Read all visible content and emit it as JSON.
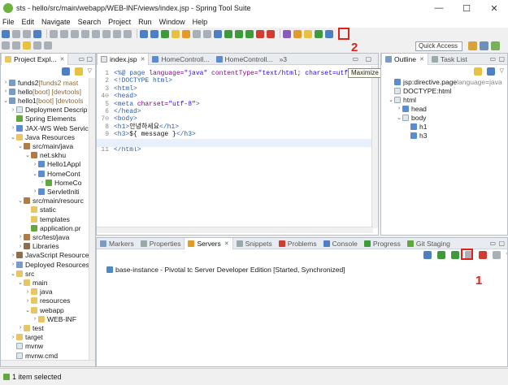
{
  "window": {
    "title": "sts - hello/src/main/webapp/WEB-INF/views/index.jsp - Spring Tool Suite",
    "minimize": "—",
    "maximize": "☐",
    "close": "✕"
  },
  "menu": [
    "File",
    "Edit",
    "Navigate",
    "Search",
    "Project",
    "Run",
    "Window",
    "Help"
  ],
  "toolbar": {
    "quick_access": "Quick Access"
  },
  "explorer": {
    "tab_label": "Project Expl...",
    "tree": [
      {
        "label": "funds2",
        "deco": " [funds2 mast",
        "indent": 0,
        "tw": "›",
        "icon": "proj"
      },
      {
        "label": "hello",
        "deco": " [boot] [devtools]",
        "indent": 0,
        "tw": "›",
        "icon": "proj"
      },
      {
        "label": "hello1",
        "deco": " [boot] [devtools",
        "indent": 0,
        "tw": "⌄",
        "icon": "proj"
      },
      {
        "label": "Deployment Descrip",
        "deco": "",
        "indent": 1,
        "tw": "›",
        "icon": "doc"
      },
      {
        "label": "Spring Elements",
        "deco": "",
        "indent": 1,
        "tw": "",
        "icon": "green"
      },
      {
        "label": "JAX-WS Web Servic",
        "deco": "",
        "indent": 1,
        "tw": "›",
        "icon": "java"
      },
      {
        "label": "Java Resources",
        "deco": "",
        "indent": 1,
        "tw": "⌄",
        "icon": "folder"
      },
      {
        "label": "src/main/java",
        "deco": "",
        "indent": 2,
        "tw": "⌄",
        "icon": "pkg"
      },
      {
        "label": "net.skhu",
        "deco": "",
        "indent": 3,
        "tw": "⌄",
        "icon": "pkg"
      },
      {
        "label": "Hello1Appl",
        "deco": "",
        "indent": 4,
        "tw": "›",
        "icon": "java"
      },
      {
        "label": "HomeCont",
        "deco": "",
        "indent": 4,
        "tw": "⌄",
        "icon": "java"
      },
      {
        "label": "HomeCo",
        "deco": "",
        "indent": 5,
        "tw": "›",
        "icon": "green"
      },
      {
        "label": "ServletIniti",
        "deco": "",
        "indent": 4,
        "tw": "›",
        "icon": "java"
      },
      {
        "label": "src/main/resourc",
        "deco": "",
        "indent": 2,
        "tw": "⌄",
        "icon": "pkg"
      },
      {
        "label": "static",
        "deco": "",
        "indent": 3,
        "tw": "",
        "icon": "folder"
      },
      {
        "label": "templates",
        "deco": "",
        "indent": 3,
        "tw": "",
        "icon": "folder"
      },
      {
        "label": "application.pr",
        "deco": "",
        "indent": 3,
        "tw": "",
        "icon": "green"
      },
      {
        "label": "src/test/java",
        "deco": "",
        "indent": 2,
        "tw": "›",
        "icon": "pkg"
      },
      {
        "label": "Libraries",
        "deco": "",
        "indent": 2,
        "tw": "›",
        "icon": "lib"
      },
      {
        "label": "JavaScript Resources",
        "deco": "",
        "indent": 1,
        "tw": "›",
        "icon": "lib"
      },
      {
        "label": "Deployed Resources",
        "deco": "",
        "indent": 1,
        "tw": "›",
        "icon": "proj"
      },
      {
        "label": "src",
        "deco": "",
        "indent": 1,
        "tw": "⌄",
        "icon": "folder"
      },
      {
        "label": "main",
        "deco": "",
        "indent": 2,
        "tw": "⌄",
        "icon": "folder"
      },
      {
        "label": "java",
        "deco": "",
        "indent": 3,
        "tw": "›",
        "icon": "folder"
      },
      {
        "label": "resources",
        "deco": "",
        "indent": 3,
        "tw": "›",
        "icon": "folder"
      },
      {
        "label": "webapp",
        "deco": "",
        "indent": 3,
        "tw": "⌄",
        "icon": "folder"
      },
      {
        "label": "WEB-INF",
        "deco": "",
        "indent": 4,
        "tw": "›",
        "icon": "folder"
      },
      {
        "label": "test",
        "deco": "",
        "indent": 2,
        "tw": "›",
        "icon": "folder"
      },
      {
        "label": "target",
        "deco": "",
        "indent": 1,
        "tw": "›",
        "icon": "folder"
      },
      {
        "label": "mvnw",
        "deco": "",
        "indent": 1,
        "tw": "",
        "icon": "doc"
      },
      {
        "label": "mvnw.cmd",
        "deco": "",
        "indent": 1,
        "tw": "",
        "icon": "doc"
      }
    ]
  },
  "editor": {
    "tabs": [
      "index.jsp",
      "HomeControll...",
      "HomeControll...",
      "»3"
    ],
    "lines": [
      {
        "n": "1",
        "parts": [
          [
            "tag",
            "<%@ page "
          ],
          [
            "attr",
            "language="
          ],
          [
            "val",
            "\"java\""
          ],
          [
            "attr",
            " contentType="
          ],
          [
            "val",
            "\"text/html; charset=utf-8\""
          ],
          [
            "attr",
            " pageEnc"
          ]
        ]
      },
      {
        "n": "2",
        "parts": [
          [
            "tag",
            "<!DOCTYPE html>"
          ]
        ]
      },
      {
        "n": "3",
        "parts": [
          [
            "tag",
            "<html>"
          ]
        ]
      },
      {
        "n": "4⊖",
        "parts": [
          [
            "tag",
            "<head>"
          ]
        ]
      },
      {
        "n": "5",
        "parts": [
          [
            "tag",
            "<meta "
          ],
          [
            "attr",
            "charset="
          ],
          [
            "val",
            "\"utf-8\""
          ],
          [
            "tag",
            ">"
          ]
        ]
      },
      {
        "n": "6",
        "parts": [
          [
            "tag",
            "</head>"
          ]
        ]
      },
      {
        "n": "7⊖",
        "parts": [
          [
            "tag",
            "<body>"
          ]
        ]
      },
      {
        "n": "8",
        "parts": [
          [
            "tag",
            "<h1>"
          ],
          [
            "plain",
            "안녕하세요"
          ],
          [
            "tag",
            "</h1>"
          ]
        ]
      },
      {
        "n": "9",
        "parts": [
          [
            "tag",
            "<h3>"
          ],
          [
            "plain",
            "${ message }"
          ],
          [
            "tag",
            "</h3>"
          ]
        ]
      },
      {
        "n": "10",
        "parts": [
          [
            "tag",
            "</body>"
          ]
        ]
      },
      {
        "n": "11",
        "parts": [
          [
            "tag",
            "</html>"
          ]
        ]
      }
    ],
    "maximize_tooltip": "Maximize"
  },
  "outline": {
    "tabs": [
      "Outline",
      "Task List"
    ],
    "tree": [
      {
        "label": "jsp:directive.page",
        "deco": " language=java",
        "indent": 0,
        "tw": "",
        "icon": "tag"
      },
      {
        "label": "DOCTYPE:html",
        "deco": "",
        "indent": 0,
        "tw": "",
        "icon": "doc"
      },
      {
        "label": "html",
        "deco": "",
        "indent": 0,
        "tw": "⌄",
        "icon": "doc"
      },
      {
        "label": "head",
        "deco": "",
        "indent": 1,
        "tw": "›",
        "icon": "tag"
      },
      {
        "label": "body",
        "deco": "",
        "indent": 1,
        "tw": "⌄",
        "icon": "doc"
      },
      {
        "label": "h1",
        "deco": "",
        "indent": 2,
        "tw": "",
        "icon": "tag"
      },
      {
        "label": "h3",
        "deco": "",
        "indent": 2,
        "tw": "",
        "icon": "tag"
      }
    ]
  },
  "bottom": {
    "tabs": [
      "Markers",
      "Properties",
      "Servers",
      "Snippets",
      "Problems",
      "Console",
      "Progress",
      "Git Staging"
    ],
    "server_entry": "base-instance - Pivotal tc Server Developer Edition  [Started, Synchronized]"
  },
  "annotations": {
    "one": "1",
    "two": "2",
    "color": "#e0201b"
  },
  "status": {
    "text": "1 item selected"
  }
}
